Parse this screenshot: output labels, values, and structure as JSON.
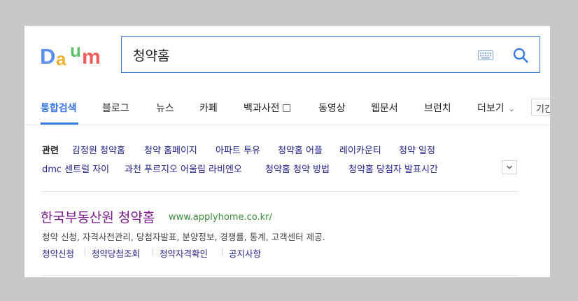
{
  "header": {
    "logo": {
      "letters": [
        "D",
        "a",
        "u",
        "m"
      ],
      "colors": [
        "#5a8ff0",
        "#f0b133",
        "#5cc16a",
        "#ef5a5a"
      ]
    },
    "search": {
      "value": "청약홈",
      "keyboard_icon": "keyboard-icon",
      "submit_icon": "search-icon"
    }
  },
  "tabs": {
    "items": [
      {
        "label": "통합검색",
        "active": true
      },
      {
        "label": "블로그"
      },
      {
        "label": "뉴스"
      },
      {
        "label": "카페"
      },
      {
        "label": "백과사전"
      },
      {
        "label": "동영상"
      },
      {
        "label": "웹문서"
      },
      {
        "label": "브런치"
      },
      {
        "label": "더보기"
      }
    ],
    "extra_input_value": "기간"
  },
  "related": {
    "label": "관련",
    "items": [
      "감정원 청약홈",
      "청약 홈페이지",
      "아파트 투유",
      "청약홈 어플",
      "레이카운티",
      "청약 일정",
      "dmc 센트럴 자이",
      "과천 푸르지오 어울림 라비엔오",
      "청약홈 청약 방법",
      "청약홈 당첨자 발표시간"
    ]
  },
  "result": {
    "title": "한국부동산원 청약홈",
    "url": "www.applyhome.co.kr/",
    "description": "청약 신청, 자격사전관리, 당첨자발표, 분양정보, 경쟁률, 통계, 고객센터 제공.",
    "sublinks": [
      "청약신청",
      "청약당첨조회",
      "청약자격확인",
      "공지사항"
    ]
  },
  "colors": {
    "accent": "#3a77e0",
    "link": "#24248a",
    "visited_title": "#7a1b8a",
    "url_green": "#3a8a3a"
  }
}
